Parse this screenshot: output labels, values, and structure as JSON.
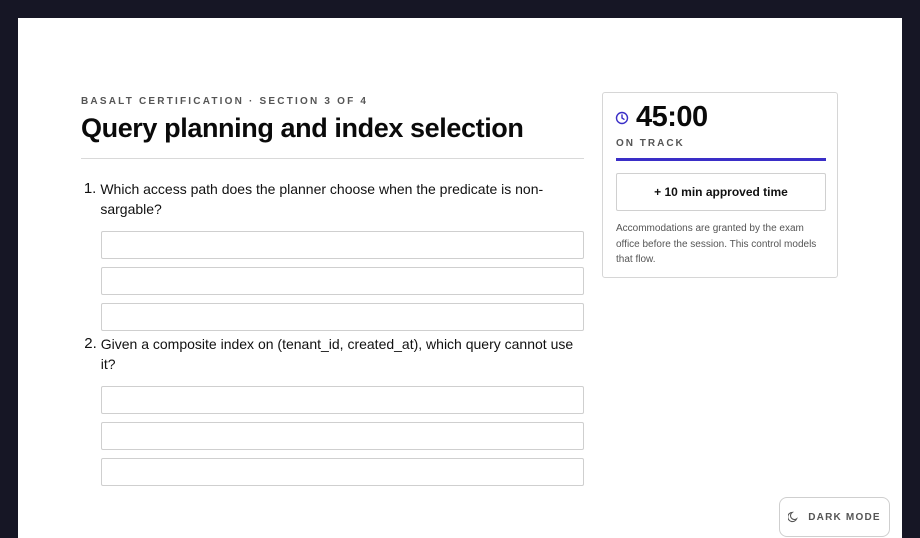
{
  "header": {
    "eyebrow": "BASALT CERTIFICATION · SECTION 3 OF 4",
    "title": "Query planning and index selection"
  },
  "questions": [
    {
      "number": "1.",
      "text": "Which access path does the planner choose when the predicate is non-sargable?",
      "option_count": 3
    },
    {
      "number": "2.",
      "text": "Given a composite index on (tenant_id, created_at), which query cannot use it?",
      "option_count": 3
    }
  ],
  "timer": {
    "icon": "clock-icon",
    "value": "45:00",
    "status": "ON TRACK",
    "progress": 1.0,
    "accent_color": "#3a2ec7",
    "extra_time_label": "+ 10 min approved time",
    "note": "Accommodations are granted by the exam office before the session. This control models that flow."
  },
  "theme_toggle": {
    "icon": "moon-icon",
    "label": "DARK MODE"
  }
}
